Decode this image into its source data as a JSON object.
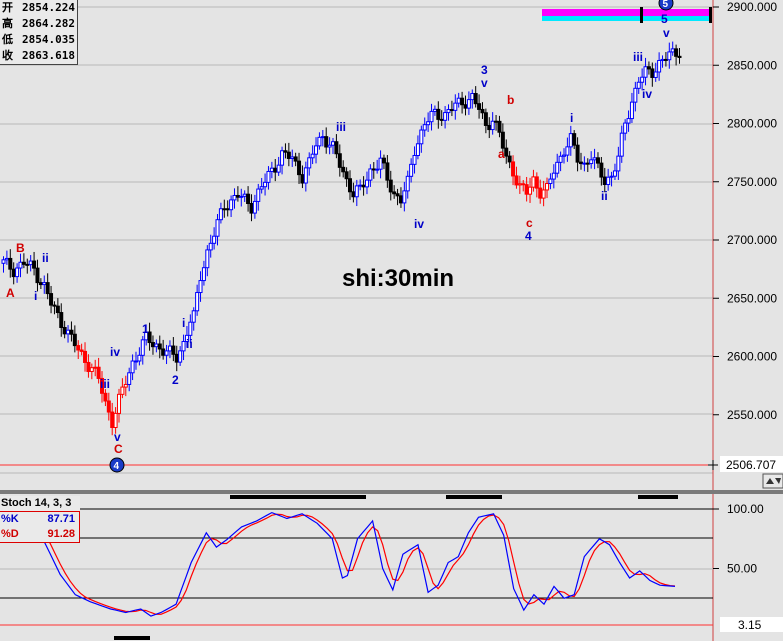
{
  "ohlc": {
    "open_label": "开",
    "open": "2854.224",
    "high_label": "高",
    "high": "2864.282",
    "low_label": "低",
    "low": "2854.035",
    "close_label": "收",
    "close": "2863.618"
  },
  "chart_title": "shi:30min",
  "indicator": {
    "title": "Stoch 14, 3, 3",
    "k_label": "%K",
    "k_value": "87.71",
    "d_label": "%D",
    "d_value": "91.28"
  },
  "colors": {
    "background": "#e4e4e4",
    "up": "#0000ff",
    "down": "#000000",
    "down_red": "#ff0000",
    "wave_blue": "#0000c8",
    "wave_red": "#d00000",
    "stoch_k": "#0000ff",
    "stoch_d": "#ff0000",
    "target_magenta": "#ff00ff",
    "target_cyan": "#00e8ff"
  },
  "chart_data": {
    "type": "candlestick",
    "timeframe": "30min",
    "price_axis": {
      "ylim": [
        2500,
        2900
      ],
      "ticks": [
        "2900.000",
        "2850.000",
        "2800.000",
        "2750.000",
        "2700.000",
        "2650.000",
        "2600.000",
        "2550.000",
        "2500.000"
      ],
      "current_value": "2506.707"
    },
    "stoch_axis": {
      "ylim": [
        0,
        100
      ],
      "ticks": [
        "100.00",
        "50.00"
      ],
      "current_value": "3.15"
    },
    "price_anchor_points": [
      [
        0,
        2680
      ],
      [
        3,
        2675
      ],
      [
        6,
        2680
      ],
      [
        9,
        2675
      ],
      [
        12,
        2660
      ],
      [
        14,
        2645
      ],
      [
        18,
        2625
      ],
      [
        22,
        2605
      ],
      [
        26,
        2590
      ],
      [
        28,
        2580
      ],
      [
        30,
        2560
      ],
      [
        32,
        2545
      ],
      [
        35,
        2570
      ],
      [
        38,
        2595
      ],
      [
        40,
        2605
      ],
      [
        42,
        2615
      ],
      [
        45,
        2610
      ],
      [
        48,
        2603
      ],
      [
        51,
        2600
      ],
      [
        53,
        2612
      ],
      [
        55,
        2630
      ],
      [
        56,
        2633
      ],
      [
        58,
        2670
      ],
      [
        60,
        2690
      ],
      [
        62,
        2705
      ],
      [
        65,
        2730
      ],
      [
        69,
        2738
      ],
      [
        73,
        2730
      ],
      [
        76,
        2745
      ],
      [
        79,
        2760
      ],
      [
        82,
        2773
      ],
      [
        85,
        2770
      ],
      [
        88,
        2755
      ],
      [
        90,
        2765
      ],
      [
        92,
        2782
      ],
      [
        94,
        2790
      ],
      [
        97,
        2778
      ],
      [
        99,
        2765
      ],
      [
        101,
        2752
      ],
      [
        103,
        2740
      ],
      [
        105,
        2742
      ],
      [
        108,
        2760
      ],
      [
        111,
        2767
      ],
      [
        113,
        2752
      ],
      [
        115,
        2740
      ],
      [
        117,
        2735
      ],
      [
        119,
        2748
      ],
      [
        121,
        2778
      ],
      [
        124,
        2800
      ],
      [
        127,
        2808
      ],
      [
        130,
        2808
      ],
      [
        133,
        2815
      ],
      [
        136,
        2820
      ],
      [
        138,
        2822
      ],
      [
        140,
        2812
      ],
      [
        142,
        2798
      ],
      [
        144,
        2805
      ],
      [
        146,
        2790
      ],
      [
        148,
        2770
      ],
      [
        150,
        2760
      ],
      [
        152,
        2745
      ],
      [
        154,
        2740
      ],
      [
        156,
        2752
      ],
      [
        158,
        2742
      ],
      [
        160,
        2742
      ],
      [
        162,
        2760
      ],
      [
        165,
        2778
      ],
      [
        167,
        2785
      ],
      [
        169,
        2770
      ],
      [
        171,
        2765
      ],
      [
        173,
        2772
      ],
      [
        175,
        2760
      ],
      [
        177,
        2752
      ],
      [
        179,
        2755
      ],
      [
        181,
        2770
      ],
      [
        183,
        2800
      ],
      [
        185,
        2820
      ],
      [
        187,
        2837
      ],
      [
        189,
        2843
      ],
      [
        191,
        2845
      ],
      [
        193,
        2852
      ],
      [
        196,
        2858
      ],
      [
        199,
        2863
      ]
    ],
    "stochastic": {
      "anchor_points": [
        [
          0,
          80
        ],
        [
          4,
          45
        ],
        [
          7,
          28
        ],
        [
          10,
          22
        ],
        [
          14,
          16
        ],
        [
          17,
          13
        ],
        [
          20,
          16
        ],
        [
          22,
          10
        ],
        [
          24,
          13
        ],
        [
          27,
          20
        ],
        [
          30,
          55
        ],
        [
          33,
          80
        ],
        [
          35,
          68
        ],
        [
          37,
          74
        ],
        [
          40,
          85
        ],
        [
          43,
          90
        ],
        [
          46,
          97
        ],
        [
          49,
          92
        ],
        [
          52,
          96
        ],
        [
          55,
          88
        ],
        [
          58,
          75
        ],
        [
          60,
          42
        ],
        [
          61,
          44
        ],
        [
          63,
          75
        ],
        [
          66,
          90
        ],
        [
          68,
          50
        ],
        [
          70,
          32
        ],
        [
          72,
          62
        ],
        [
          75,
          70
        ],
        [
          77,
          30
        ],
        [
          79,
          36
        ],
        [
          81,
          55
        ],
        [
          83,
          60
        ],
        [
          85,
          80
        ],
        [
          87,
          93
        ],
        [
          90,
          96
        ],
        [
          92,
          78
        ],
        [
          94,
          33
        ],
        [
          96,
          15
        ],
        [
          98,
          28
        ],
        [
          100,
          20
        ],
        [
          102,
          35
        ],
        [
          104,
          25
        ],
        [
          106,
          28
        ],
        [
          108,
          60
        ],
        [
          111,
          75
        ],
        [
          113,
          70
        ],
        [
          115,
          55
        ],
        [
          117,
          42
        ],
        [
          119,
          48
        ],
        [
          121,
          40
        ],
        [
          123,
          36
        ],
        [
          126,
          35
        ]
      ]
    },
    "wave_labels": [
      {
        "text": "A",
        "color": "red"
      },
      {
        "text": "B",
        "color": "red"
      },
      {
        "text": "i",
        "color": "blue"
      },
      {
        "text": "ii",
        "color": "blue"
      },
      {
        "text": "iii",
        "color": "blue"
      },
      {
        "text": "iv",
        "color": "blue"
      },
      {
        "text": "v",
        "color": "blue"
      },
      {
        "text": "C",
        "color": "red"
      },
      {
        "text": "1",
        "color": "blue"
      },
      {
        "text": "2",
        "color": "blue"
      },
      {
        "text": "i",
        "color": "blue"
      },
      {
        "text": "ii",
        "color": "blue"
      },
      {
        "text": "iii",
        "color": "blue"
      },
      {
        "text": "iv",
        "color": "blue"
      },
      {
        "text": "3",
        "color": "blue"
      },
      {
        "text": "v",
        "color": "blue"
      },
      {
        "text": "b",
        "color": "red"
      },
      {
        "text": "a",
        "color": "red"
      },
      {
        "text": "c",
        "color": "red"
      },
      {
        "text": "4",
        "color": "blue"
      },
      {
        "text": "i",
        "color": "blue"
      },
      {
        "text": "ii",
        "color": "blue"
      },
      {
        "text": "iii",
        "color": "blue"
      },
      {
        "text": "iv",
        "color": "blue"
      },
      {
        "text": "5",
        "color": "blue"
      },
      {
        "text": "v",
        "color": "blue"
      }
    ],
    "circle_markers": [
      "4",
      "5"
    ],
    "target_zone": {
      "low": 2885,
      "high": 2898
    }
  }
}
